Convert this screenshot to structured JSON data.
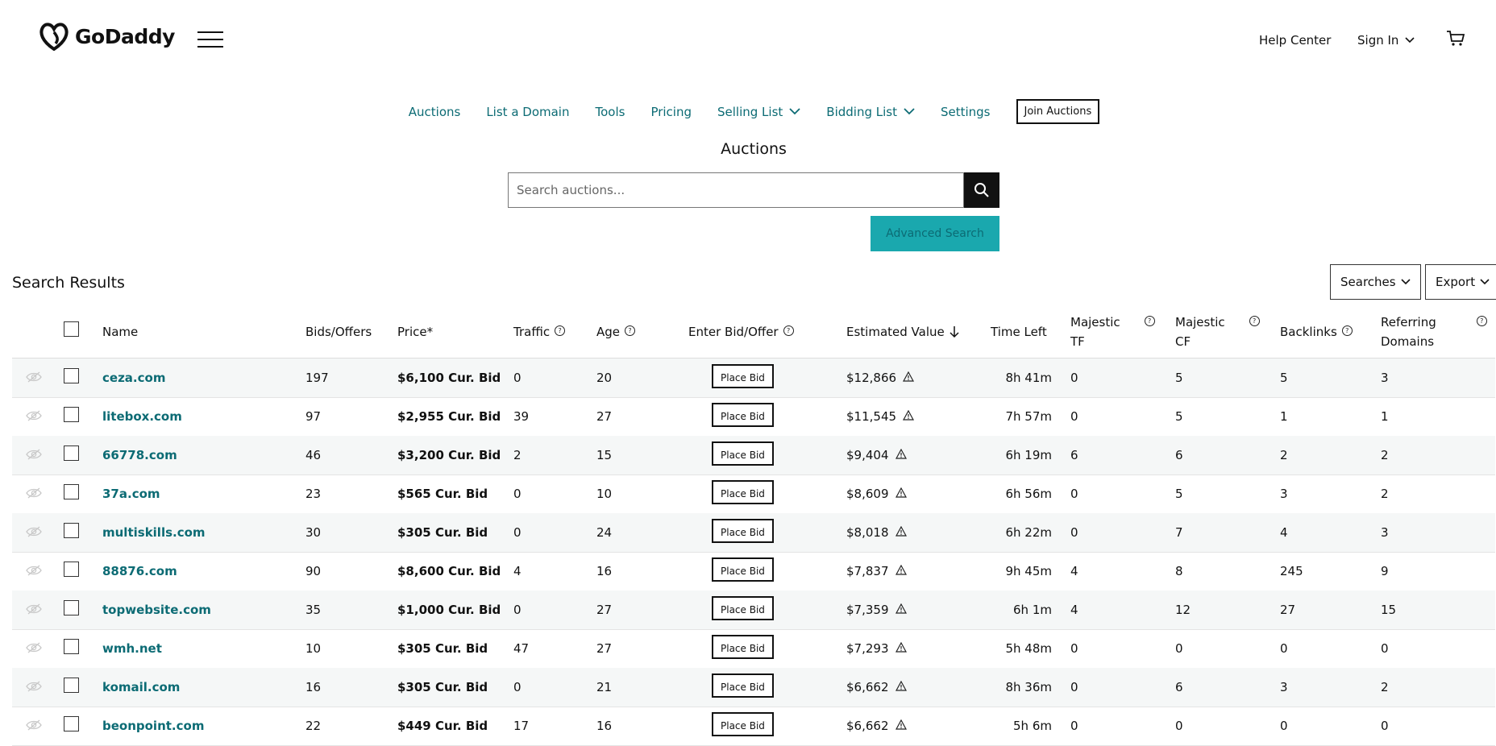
{
  "header": {
    "brand": "GoDaddy",
    "help_center": "Help Center",
    "sign_in": "Sign In",
    "icons": [
      "godaddy-logo-icon",
      "hamburger-menu-icon",
      "chevron-down-icon",
      "cart-icon"
    ]
  },
  "nav": {
    "items": [
      {
        "label": "Auctions",
        "dropdown": false
      },
      {
        "label": "List a Domain",
        "dropdown": false
      },
      {
        "label": "Tools",
        "dropdown": false
      },
      {
        "label": "Pricing",
        "dropdown": false
      },
      {
        "label": "Selling List",
        "dropdown": true
      },
      {
        "label": "Bidding List",
        "dropdown": true
      },
      {
        "label": "Settings",
        "dropdown": false
      }
    ],
    "join_label": "Join Auctions"
  },
  "page_title": "Auctions",
  "search": {
    "placeholder": "Search auctions...",
    "value": "",
    "advanced_label": "Advanced Search"
  },
  "results": {
    "title": "Search Results",
    "searches_label": "Searches",
    "export_label": "Export"
  },
  "colors": {
    "link": "#0c6b74",
    "accent": "#1aa8ae"
  },
  "table": {
    "headers": {
      "name": "Name",
      "bids": "Bids/Offers",
      "price": "Price*",
      "traffic": "Traffic",
      "age": "Age",
      "enter_bid": "Enter Bid/Offer",
      "est_value": "Estimated Value",
      "time_left": "Time Left",
      "majestic_tf_1": "Majestic",
      "majestic_tf_2": "TF",
      "majestic_cf_1": "Majestic",
      "majestic_cf_2": "CF",
      "backlinks": "Backlinks",
      "ref_1": "Referring",
      "ref_2": "Domains"
    },
    "place_bid_label": "Place Bid",
    "rows": [
      {
        "name": "ceza.com",
        "bids": "197",
        "price": "$6,100 Cur. Bid",
        "traffic": "0",
        "age": "20",
        "value": "$12,866",
        "time": "8h 41m",
        "tf": "0",
        "cf": "5",
        "backlinks": "5",
        "ref": "3"
      },
      {
        "name": "litebox.com",
        "bids": "97",
        "price": "$2,955 Cur. Bid",
        "traffic": "39",
        "age": "27",
        "value": "$11,545",
        "time": "7h 57m",
        "tf": "0",
        "cf": "5",
        "backlinks": "1",
        "ref": "1"
      },
      {
        "name": "66778.com",
        "bids": "46",
        "price": "$3,200 Cur. Bid",
        "traffic": "2",
        "age": "15",
        "value": "$9,404",
        "time": "6h 19m",
        "tf": "6",
        "cf": "6",
        "backlinks": "2",
        "ref": "2"
      },
      {
        "name": "37a.com",
        "bids": "23",
        "price": "$565 Cur. Bid",
        "traffic": "0",
        "age": "10",
        "value": "$8,609",
        "time": "6h 56m",
        "tf": "0",
        "cf": "5",
        "backlinks": "3",
        "ref": "2"
      },
      {
        "name": "multiskills.com",
        "bids": "30",
        "price": "$305 Cur. Bid",
        "traffic": "0",
        "age": "24",
        "value": "$8,018",
        "time": "6h 22m",
        "tf": "0",
        "cf": "7",
        "backlinks": "4",
        "ref": "3"
      },
      {
        "name": "88876.com",
        "bids": "90",
        "price": "$8,600 Cur. Bid",
        "traffic": "4",
        "age": "16",
        "value": "$7,837",
        "time": "9h 45m",
        "tf": "4",
        "cf": "8",
        "backlinks": "245",
        "ref": "9"
      },
      {
        "name": "topwebsite.com",
        "bids": "35",
        "price": "$1,000 Cur. Bid",
        "traffic": "0",
        "age": "27",
        "value": "$7,359",
        "time": "6h 1m",
        "tf": "4",
        "cf": "12",
        "backlinks": "27",
        "ref": "15"
      },
      {
        "name": "wmh.net",
        "bids": "10",
        "price": "$305 Cur. Bid",
        "traffic": "47",
        "age": "27",
        "value": "$7,293",
        "time": "5h 48m",
        "tf": "0",
        "cf": "0",
        "backlinks": "0",
        "ref": "0"
      },
      {
        "name": "komail.com",
        "bids": "16",
        "price": "$305 Cur. Bid",
        "traffic": "0",
        "age": "21",
        "value": "$6,662",
        "time": "8h 36m",
        "tf": "0",
        "cf": "6",
        "backlinks": "3",
        "ref": "2"
      },
      {
        "name": "beonpoint.com",
        "bids": "22",
        "price": "$449 Cur. Bid",
        "traffic": "17",
        "age": "16",
        "value": "$6,662",
        "time": "5h 6m",
        "tf": "0",
        "cf": "0",
        "backlinks": "0",
        "ref": "0"
      }
    ]
  }
}
